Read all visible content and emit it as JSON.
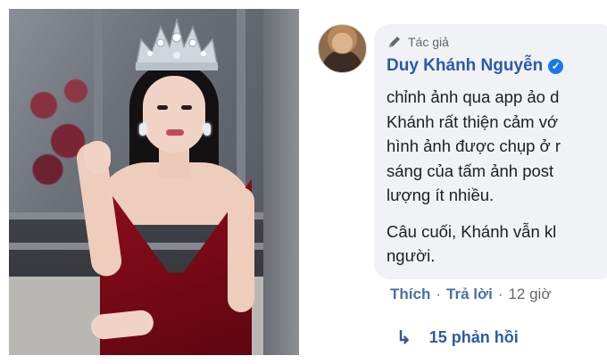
{
  "photo": {
    "description_icon": "photo-of-woman-with-crown"
  },
  "comment": {
    "badge_label": "Tác giả",
    "badge_icon": "pencil-icon",
    "author_name": "Duy Khánh Nguyễn",
    "verified_icon": "verified-check-icon",
    "lines": [
      "chỉnh ảnh qua app ảo d",
      "Khánh rất thiện cảm vớ",
      "hình ảnh được chụp ở r",
      "sáng của tấm ảnh post",
      "lượng ít nhiều."
    ],
    "lines_para2": [
      "Câu cuối, Khánh vẫn kl",
      "người."
    ],
    "actions": {
      "like": "Thích",
      "separator": "·",
      "reply": "Trả lời",
      "time": "12 giờ"
    },
    "replies": {
      "arrow_icon": "reply-arrow-icon",
      "label": "15 phản hồi"
    },
    "colors": {
      "name": "#2c5aa8",
      "bubble": "#f0f2f5",
      "verified": "#1877f2"
    }
  }
}
